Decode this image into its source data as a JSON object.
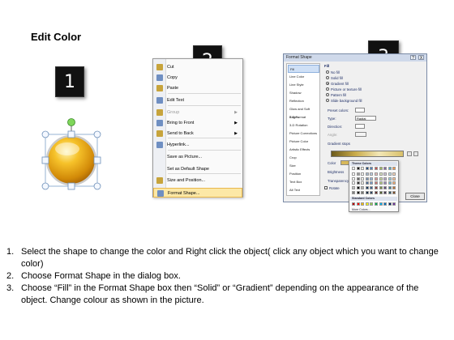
{
  "title": "Edit Color",
  "steps": [
    {
      "number": "1"
    },
    {
      "number": "2"
    },
    {
      "number": "3"
    }
  ],
  "context_menu": {
    "items": [
      {
        "label": "Cut",
        "icon": "scissors-icon",
        "disabled": false,
        "submenu": false
      },
      {
        "label": "Copy",
        "icon": "copy-icon",
        "disabled": false,
        "submenu": false
      },
      {
        "label": "Paste",
        "icon": "paste-icon",
        "disabled": false,
        "submenu": false
      },
      {
        "label": "Edit Text",
        "icon": "edit-text-icon",
        "disabled": false,
        "submenu": false
      },
      {
        "label": "Group",
        "icon": "group-icon",
        "disabled": true,
        "submenu": true
      },
      {
        "label": "Bring to Front",
        "icon": "bring-to-front-icon",
        "disabled": false,
        "submenu": true
      },
      {
        "label": "Send to Back",
        "icon": "send-to-back-icon",
        "disabled": false,
        "submenu": true
      },
      {
        "label": "Hyperlink...",
        "icon": "hyperlink-icon",
        "disabled": false,
        "submenu": false
      },
      {
        "label": "Save as Picture...",
        "icon": "",
        "disabled": false,
        "submenu": false
      },
      {
        "label": "Set as Default Shape",
        "icon": "",
        "disabled": false,
        "submenu": false
      },
      {
        "label": "Size and Position...",
        "icon": "size-position-icon",
        "disabled": false,
        "submenu": false
      },
      {
        "label": "Format Shape...",
        "icon": "format-shape-icon",
        "disabled": false,
        "submenu": false,
        "highlighted": true
      }
    ]
  },
  "dialog": {
    "title": "Format Shape",
    "help": "?",
    "close_glyph": "X",
    "categories": [
      "Fill",
      "Line Color",
      "Line Style",
      "Shadow",
      "Reflection",
      "Glow and Soft Edges",
      "3-D Format",
      "3-D Rotation",
      "Picture Corrections",
      "Picture Color",
      "Artistic Effects",
      "Crop",
      "Size",
      "Position",
      "Text Box",
      "Alt Text"
    ],
    "selected_category": "Fill",
    "panel": {
      "heading": "Fill",
      "options": [
        "No fill",
        "Solid fill",
        "Gradient fill",
        "Picture or texture fill",
        "Pattern fill",
        "Slide background fill"
      ],
      "selected_option": "Gradient fill",
      "preset_label": "Preset colors:",
      "type_label": "Type:",
      "type_value": "Radial",
      "direction_label": "Direction:",
      "angle_label": "Angle:",
      "stops_label": "Gradient stops",
      "color_label": "Color",
      "position_label": "Position:",
      "position_value": "0%",
      "brightness_label": "Brightness",
      "transparency_label": "Transparency",
      "rotate_label": "Rotate"
    },
    "color_popup": {
      "theme_label": "Theme Colors",
      "standard_label": "Standard Colors",
      "more_label": "More Colors...",
      "theme_top": [
        "#ffffff",
        "#000000",
        "#eeece1",
        "#1f497d",
        "#4f81bd",
        "#c0504d",
        "#9bbb59",
        "#8064a2",
        "#4bacc6",
        "#f79646"
      ],
      "standard": [
        "#c00000",
        "#ff0000",
        "#ffc000",
        "#ffff00",
        "#92d050",
        "#00b050",
        "#00b0f0",
        "#0070c0",
        "#002060",
        "#7030a0"
      ]
    },
    "close_button": "Close"
  },
  "instructions": [
    {
      "n": "1.",
      "text": "Select the shape to change the color and Right click the object( click any object which you want to change color)"
    },
    {
      "n": "2.",
      "text": "Choose Format Shape in the dialog box."
    },
    {
      "n": "3.",
      "text": "Choose “Fill” in the Format Shape box then “Solid” or “Gradient” depending on the appearance of the object. Change colour as shown in the picture."
    }
  ]
}
